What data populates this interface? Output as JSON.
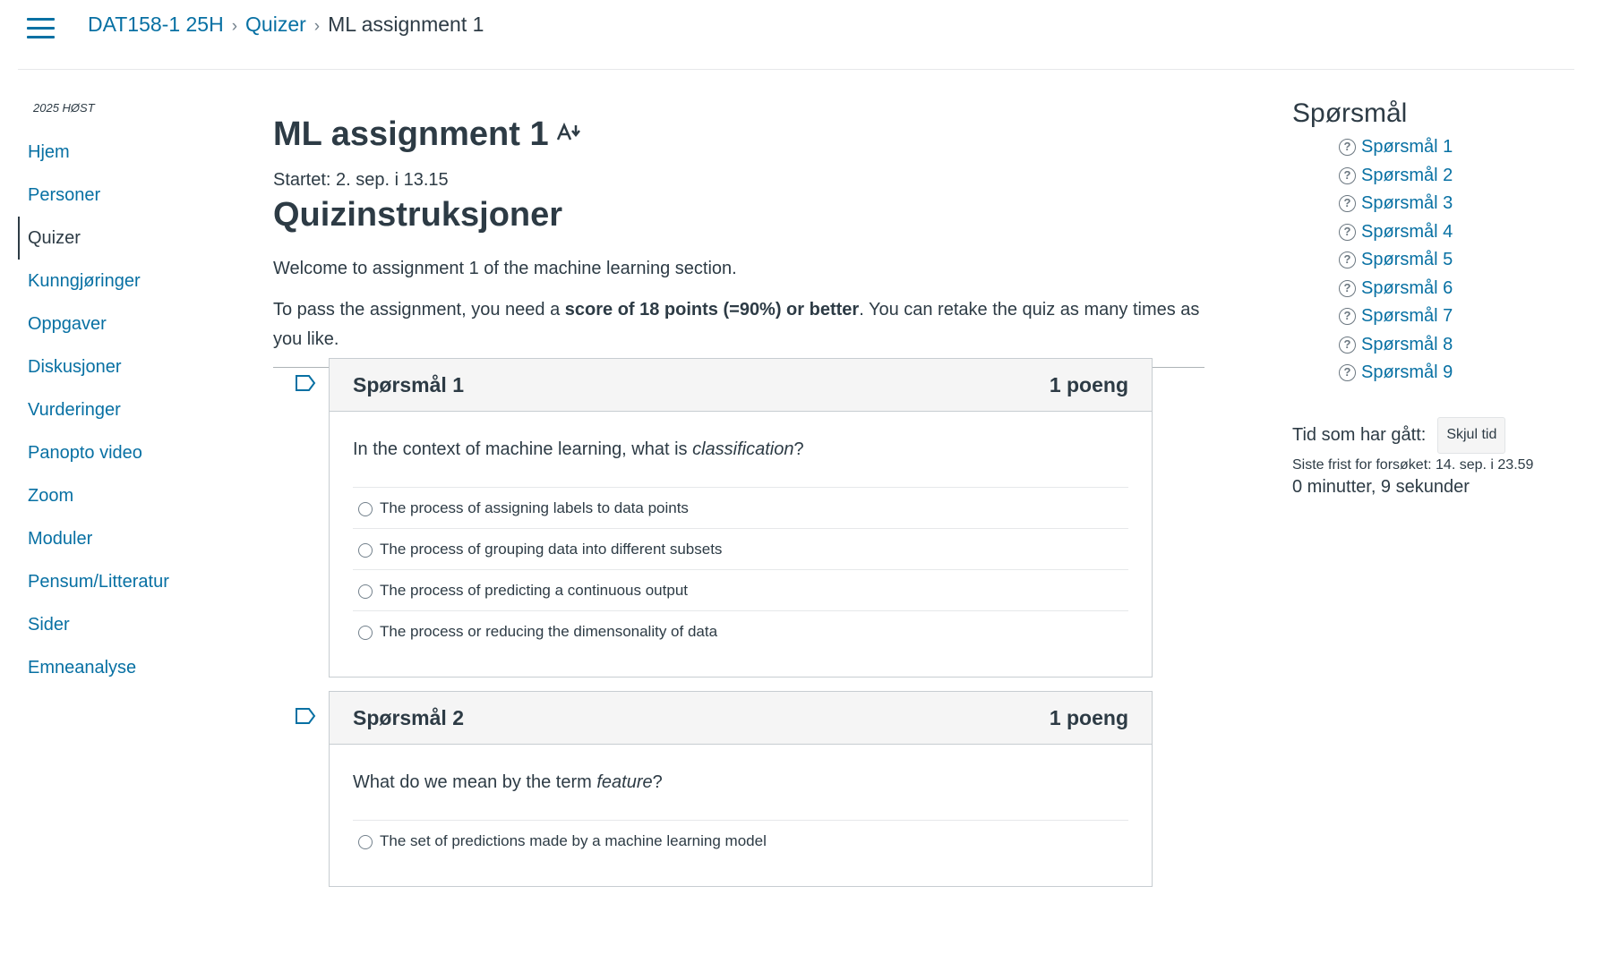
{
  "breadcrumb": {
    "course": "DAT158-1 25H",
    "section": "Quizer",
    "current": "ML assignment 1"
  },
  "nav": {
    "term": "2025 HØST",
    "items": [
      "Hjem",
      "Personer",
      "Quizer",
      "Kunngjøringer",
      "Oppgaver",
      "Diskusjoner",
      "Vurderinger",
      "Panopto video",
      "Zoom",
      "Moduler",
      "Pensum/Litteratur",
      "Sider",
      "Emneanalyse"
    ],
    "active": "Quizer"
  },
  "main": {
    "title": "ML assignment 1",
    "text_adjust_glyph": "A",
    "started": "Startet: 2. sep. i 13.15",
    "instructions_heading": "Quizinstruksjoner",
    "intro_line1": "Welcome to assignment 1 of the machine learning section.",
    "intro_line2_pre": "To pass the assignment, you need a ",
    "intro_line2_bold": "score of 18 points (=90%) or better",
    "intro_line2_post": ". You can retake the quiz as many times as you like."
  },
  "questions": [
    {
      "title": "Spørsmål 1",
      "points": "1 poeng",
      "text_pre": "In the context of machine learning, what is ",
      "text_em": "classification",
      "text_post": "?",
      "answers": [
        "The process of assigning labels to data points",
        "The process of grouping data into different subsets",
        "The process of predicting a continuous output",
        "The process or reducing the dimensonality of data"
      ]
    },
    {
      "title": "Spørsmål 2",
      "points": "1 poeng",
      "text_pre": "What do we mean by the term ",
      "text_em": "feature",
      "text_post": "?",
      "answers": [
        "The set of predictions made by a machine learning model"
      ]
    }
  ],
  "sidebar": {
    "heading": "Spørsmål",
    "question_links": [
      "Spørsmål 1",
      "Spørsmål 2",
      "Spørsmål 3",
      "Spørsmål 4",
      "Spørsmål 5",
      "Spørsmål 6",
      "Spørsmål 7",
      "Spørsmål 8",
      "Spørsmål 9"
    ],
    "timer_label": "Tid som har gått:",
    "toggle_timer": "Skjul tid",
    "deadline": "Siste frist for forsøket: 14. sep. i 23.59",
    "elapsed": "0 minutter, 9 sekunder"
  },
  "colors": {
    "link": "#0770a3",
    "text": "#2d3b45"
  }
}
